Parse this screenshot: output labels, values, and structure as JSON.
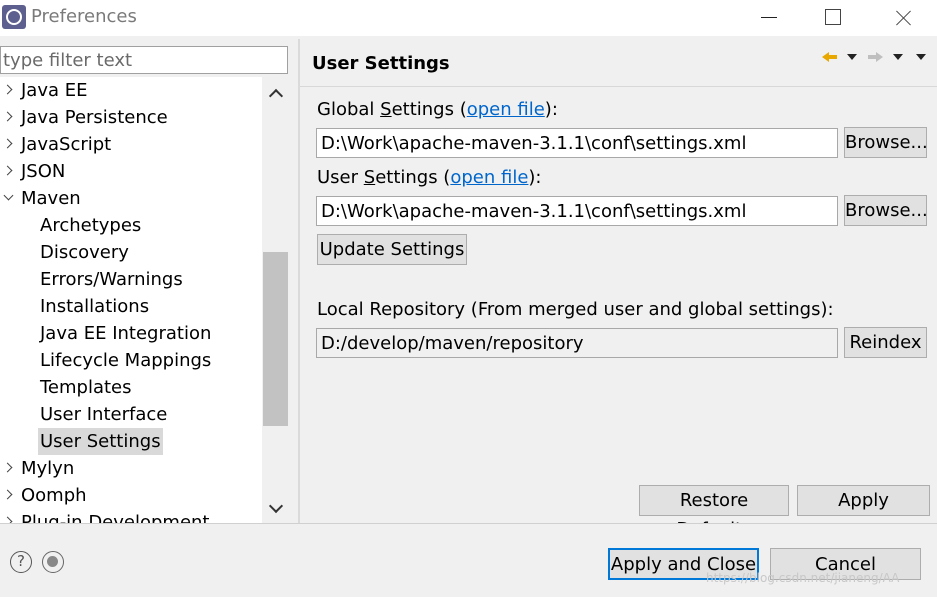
{
  "window": {
    "title": "Preferences",
    "icon": "eclipse-icon"
  },
  "filter": {
    "placeholder": "type filter text",
    "value": ""
  },
  "tree": {
    "items": [
      {
        "label": "Java EE",
        "level": 0,
        "expander": "collapsed"
      },
      {
        "label": "Java Persistence",
        "level": 0,
        "expander": "collapsed"
      },
      {
        "label": "JavaScript",
        "level": 0,
        "expander": "collapsed"
      },
      {
        "label": "JSON",
        "level": 0,
        "expander": "collapsed"
      },
      {
        "label": "Maven",
        "level": 0,
        "expander": "expanded"
      },
      {
        "label": "Archetypes",
        "level": 1
      },
      {
        "label": "Discovery",
        "level": 1
      },
      {
        "label": "Errors/Warnings",
        "level": 1
      },
      {
        "label": "Installations",
        "level": 1
      },
      {
        "label": "Java EE Integration",
        "level": 1
      },
      {
        "label": "Lifecycle Mappings",
        "level": 1
      },
      {
        "label": "Templates",
        "level": 1
      },
      {
        "label": "User Interface",
        "level": 1
      },
      {
        "label": "User Settings",
        "level": 1,
        "selected": true
      },
      {
        "label": "Mylyn",
        "level": 0,
        "expander": "collapsed"
      },
      {
        "label": "Oomph",
        "level": 0,
        "expander": "collapsed"
      },
      {
        "label": "Plug-in Development",
        "level": 0,
        "expander": "collapsed"
      }
    ]
  },
  "page": {
    "title": "User Settings",
    "global_settings": {
      "label_prefix": "Global ",
      "label_accel": "S",
      "label_rest": "ettings (",
      "link": "open file",
      "label_suffix": "):",
      "value": "D:\\Work\\apache-maven-3.1.1\\conf\\settings.xml",
      "browse": "Browse..."
    },
    "user_settings": {
      "label_prefix": "User ",
      "label_accel": "S",
      "label_rest": "ettings (",
      "link": "open file",
      "label_suffix": "):",
      "value": "D:\\Work\\apache-maven-3.1.1\\conf\\settings.xml",
      "browse": "Browse..."
    },
    "update_settings": "Update Settings",
    "local_repository": {
      "label": "Local Repository (From merged user and global settings):",
      "value": "D:/develop/maven/repository",
      "reindex": "Reindex"
    },
    "restore_defaults": "Restore Defaults",
    "apply": "Apply"
  },
  "bottom": {
    "apply_and_close": "Apply and Close",
    "cancel": "Cancel",
    "watermark": "https://blog.csdn.net/jianeng/AA"
  },
  "colors": {
    "link": "#0066cc",
    "selection": "#d9d9d9",
    "primary_border": "#0078d7",
    "nav_back": "#e8a800"
  }
}
